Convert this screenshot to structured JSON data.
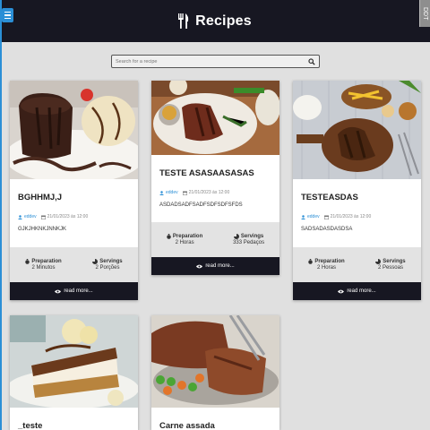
{
  "header": {
    "title": "Recipes",
    "corner_tag": "DDT"
  },
  "search": {
    "placeholder": "Search for a recipe"
  },
  "labels": {
    "preparation": "Preparation",
    "servings": "Servings",
    "read_more": "read more..."
  },
  "recipes": [
    {
      "name": "BGHHMJ,J",
      "author": "eddev",
      "date": "21/01/2023 às 12:00",
      "description": "GJKJHKNKJNNKJK",
      "preparation": "2 Minutos",
      "servings": "2 Porções"
    },
    {
      "name": "TESTE ASASAASASAS",
      "author": "eddev",
      "date": "21/01/2023 às 12:00",
      "description": "ASDADSADFSADFSDFSDFSFDS",
      "preparation": "2 Horas",
      "servings": "333 Pedaços"
    },
    {
      "name": "TESTEASDAS",
      "author": "eddev",
      "date": "21/01/2023 às 12:00",
      "description": "SADSADASDASDSA",
      "preparation": "2 Horas",
      "servings": "2 Pessoas"
    },
    {
      "name": "_teste"
    },
    {
      "name": "Carne assada"
    }
  ],
  "colors": {
    "header_bg": "#171722",
    "accent": "#2b8fd6",
    "page_bg": "#e0e0e0",
    "card_button_bg": "#171722"
  },
  "icons": {
    "menu": "hamburger-icon",
    "title": "utensils-icon",
    "search": "search-icon",
    "author": "user-icon",
    "date": "calendar-icon",
    "preparation": "timer-icon",
    "servings": "pie-icon",
    "read_more": "eye-icon"
  }
}
